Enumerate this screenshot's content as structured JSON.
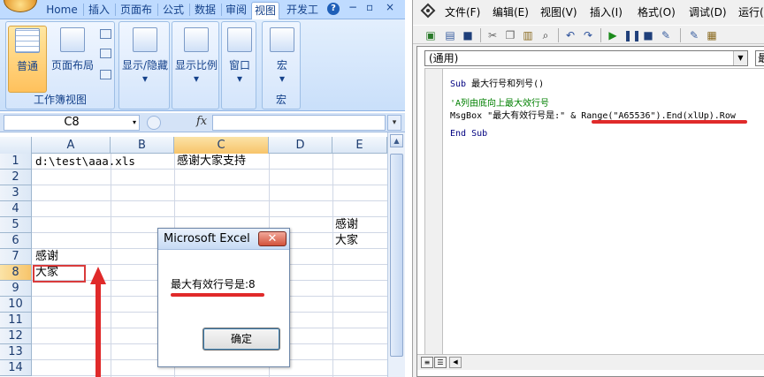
{
  "excel": {
    "tabs": [
      "Home",
      "插入",
      "页面布",
      "公式",
      "数据",
      "审阅",
      "视图",
      "开发工"
    ],
    "active_tab": "视图",
    "window_controls": [
      "−",
      "▫",
      "×"
    ],
    "ribbon": {
      "normal_label": "普通",
      "page_layout_label": "页面布局",
      "workbook_views_group": "工作簿视图",
      "show_hide_label": "显示/隐藏",
      "zoom_label": "显示比例",
      "window_label": "窗口",
      "macro_label": "宏",
      "macro_group": "宏",
      "dropdown_glyph": "▾"
    },
    "name_box": "C8",
    "fx_label": "fx",
    "columns": [
      "A",
      "B",
      "C",
      "D",
      "E"
    ],
    "rows": [
      "1",
      "2",
      "3",
      "4",
      "5",
      "6",
      "7",
      "8",
      "9",
      "10",
      "11",
      "12",
      "13",
      "14"
    ],
    "cells": {
      "a1": "d:\\test\\aaa.xls",
      "c1": "感谢大家支持",
      "e5": "感谢",
      "e6": "大家",
      "a7": "感谢",
      "a8": "大家"
    }
  },
  "msgbox": {
    "title": "Microsoft Excel",
    "close_glyph": "✕",
    "message": "最大有效行号是:8",
    "ok_label": "确定"
  },
  "vbe": {
    "menu": [
      "文件(F)",
      "编辑(E)",
      "视图(V)",
      "插入(I)",
      "格式(O)",
      "调试(D)",
      "运行("
    ],
    "proc_combo": "(通用)",
    "proc_combo2": "最",
    "code": {
      "line1_kw": "Sub",
      "line1_rest": " 最大行号和列号()",
      "line2": "'A列由底向上最大效行号",
      "line3": "MsgBox \"最大有效行号是:\" & Range(\"A65536\").End(xlUp).Row",
      "line4": "End Sub"
    }
  },
  "colors": {
    "ribbon_blue": "#bfdbff",
    "annotation_red": "#e02a2a",
    "comment_green": "#008000",
    "keyword_navy": "#000080"
  }
}
